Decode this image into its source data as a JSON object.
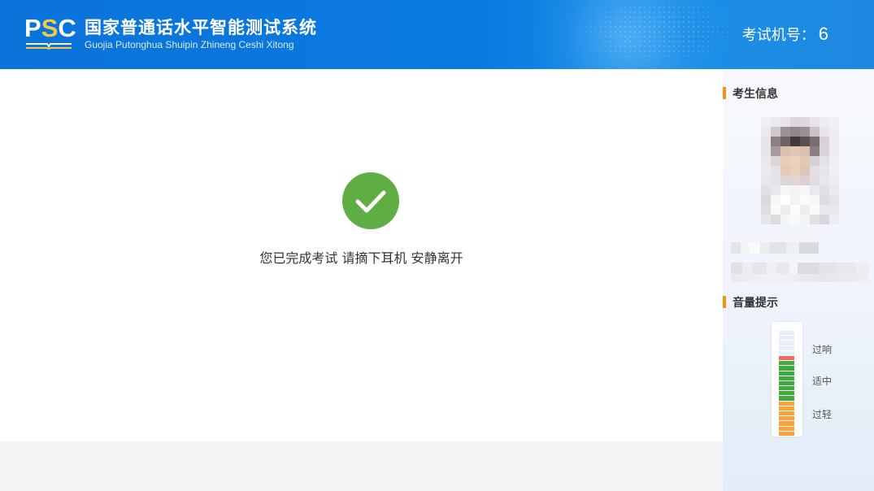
{
  "header": {
    "logo": "PSC",
    "title_cn": "国家普通话水平智能测试系统",
    "title_en": "Guojia Putonghua Shuipin Zhineng Ceshi Xitong",
    "machine_label": "考试机号：",
    "machine_number": "6"
  },
  "main": {
    "status_icon": "check-circle-icon",
    "message": "您已完成考试 请摘下耳机 安静离开"
  },
  "sidebar": {
    "candidate_title": "考生信息",
    "volume_title": "音量提示",
    "volume_labels": {
      "loud": "过响",
      "ok": "适中",
      "quiet": "过轻"
    }
  },
  "colors": {
    "header_blue": "#0a73d9",
    "accent_orange": "#f5921e",
    "success_green": "#5fae44",
    "meter_red": "#ef6b5f",
    "meter_green": "#3cab3c",
    "meter_orange": "#f7a23a",
    "meter_empty": "#e9eef8"
  }
}
